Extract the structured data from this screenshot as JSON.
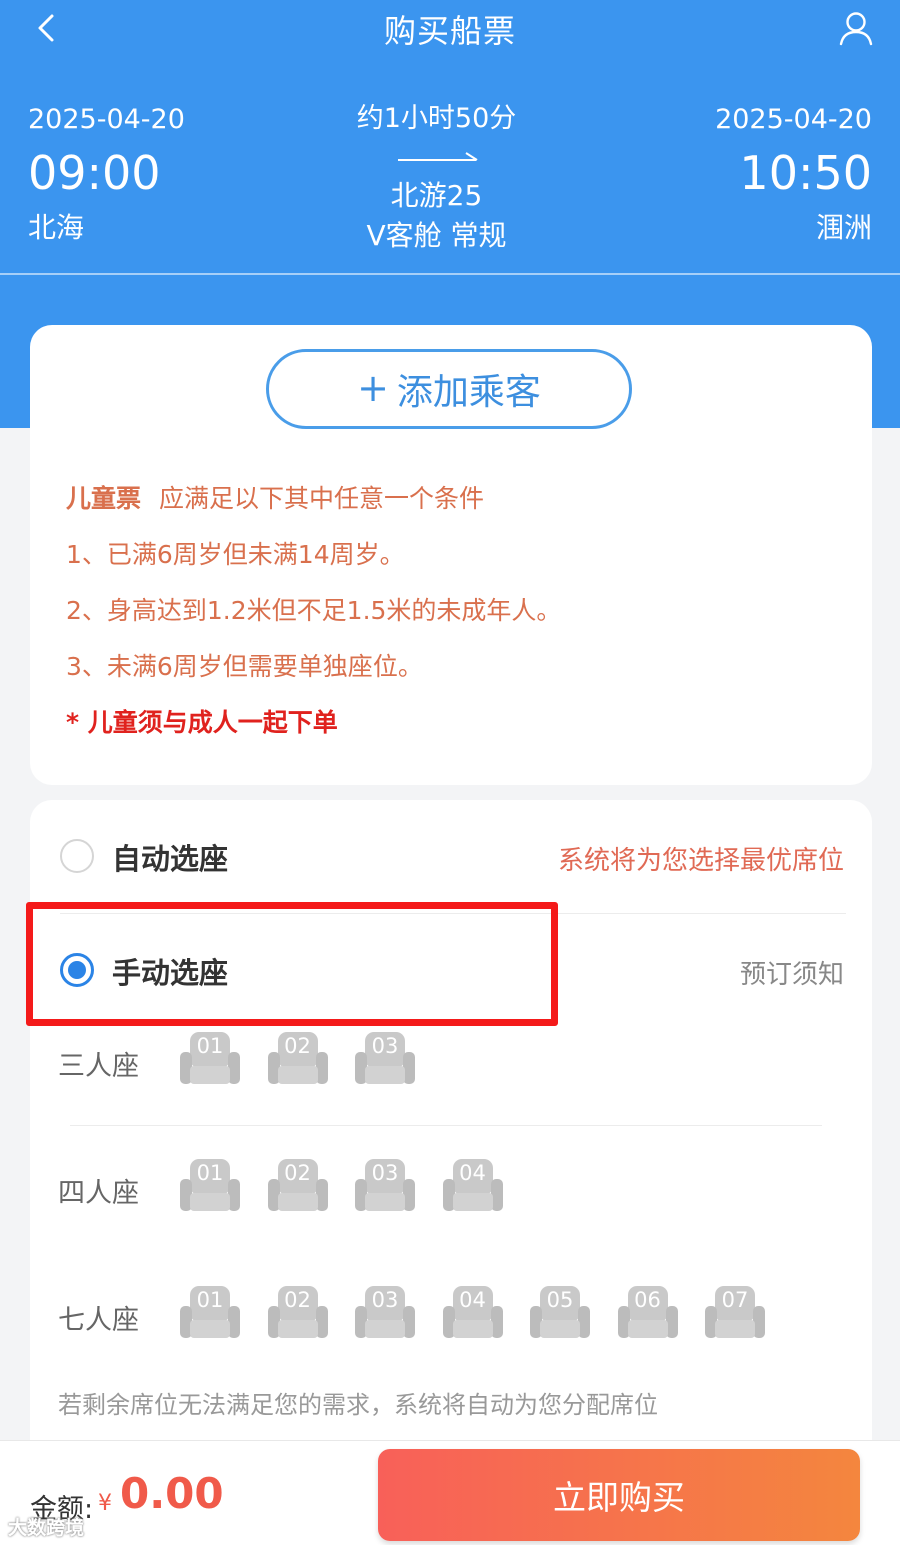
{
  "header": {
    "title": "购买船票",
    "back_icon": "chevron-left-icon",
    "user_icon": "user-icon"
  },
  "trip": {
    "departure": {
      "date": "2025-04-20",
      "time": "09:00",
      "port": "北海"
    },
    "arrival": {
      "date": "2025-04-20",
      "time": "10:50",
      "port": "涠洲"
    },
    "duration": "约1小时50分",
    "vessel": "北游25",
    "cabin": "V客舱 常规"
  },
  "passenger": {
    "add_label": "添加乘客",
    "add_plus": "+",
    "child_rule_title": "儿童票",
    "child_rule_intro": "应满足以下其中任意一个条件",
    "rules": [
      "1、已满6周岁但未满14周岁。",
      "2、身高达到1.2米但不足1.5米的未成年人。",
      "3、未满6周岁但需要单独座位。"
    ],
    "note": "* 儿童须与成人一起下单"
  },
  "seat_selection": {
    "auto_label": "自动选座",
    "auto_hint": "系统将为您选择最优席位",
    "manual_label": "手动选座",
    "manual_selected": true,
    "notice_link": "预订须知",
    "rows": [
      {
        "label": "三人座",
        "seats": [
          "01",
          "02",
          "03"
        ]
      },
      {
        "label": "四人座",
        "seats": [
          "01",
          "02",
          "03",
          "04"
        ]
      },
      {
        "label": "七人座",
        "seats": [
          "01",
          "02",
          "03",
          "04",
          "05",
          "06",
          "07"
        ]
      }
    ],
    "remain_note": "若剩余席位无法满足您的需求，系统将自动为您分配席位"
  },
  "footer": {
    "amount_label": "金额:",
    "currency": "¥",
    "amount": "0.00",
    "buy_label": "立即购买",
    "watermark": "大数跨境"
  },
  "colors": {
    "header_bg": "#3b95ef",
    "accent_blue": "#2b84e6",
    "rule_text": "#d9704d",
    "note_red": "#e0221e",
    "price_red": "#f05a4a",
    "buy_gradient_start": "#f86059",
    "buy_gradient_end": "#f4863e",
    "highlight_red": "#f41a1a"
  }
}
